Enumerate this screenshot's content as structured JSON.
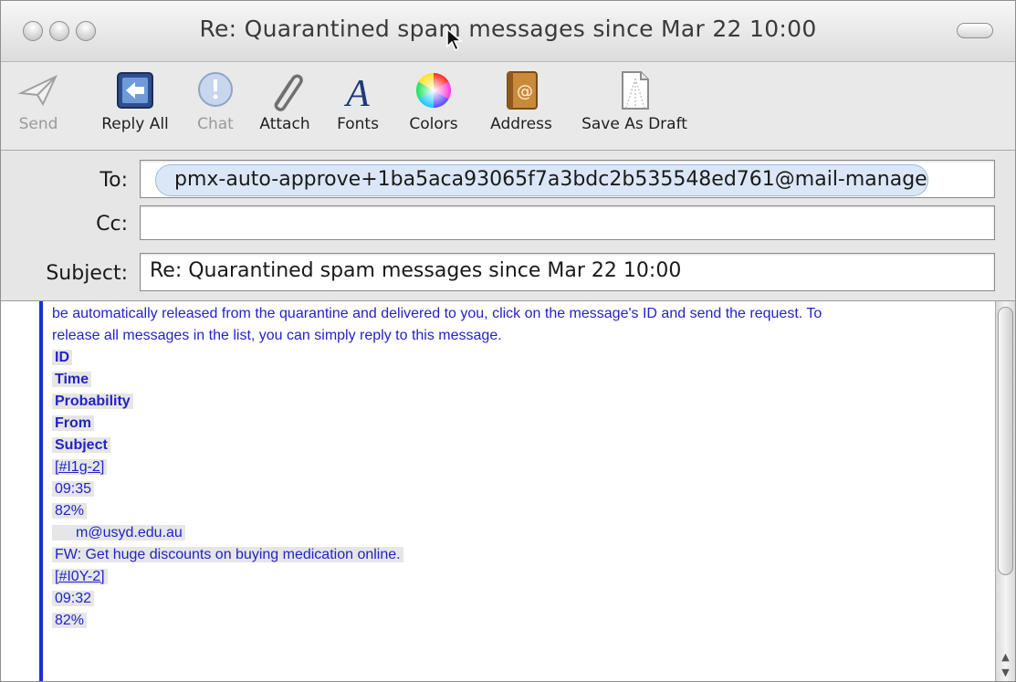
{
  "window": {
    "title": "Re: Quarantined spam messages since Mar 22 10:00"
  },
  "toolbar": {
    "send": "Send",
    "reply_all": "Reply All",
    "chat": "Chat",
    "attach": "Attach",
    "fonts": "Fonts",
    "colors": "Colors",
    "address": "Address",
    "save_draft": "Save As Draft"
  },
  "fields": {
    "to_label": "To:",
    "to_value": "pmx-auto-approve+1ba5aca93065f7a3bdc2b535548ed761@mail-manage",
    "cc_label": "Cc:",
    "cc_value": "",
    "subject_label": "Subject:",
    "subject_value": "Re: Quarantined spam messages since Mar 22 10:00"
  },
  "body": {
    "intro_line1": "be automatically released from the quarantine and delivered to you, click on the message's ID and send the request. To",
    "intro_line2": "release all messages in the list, you can simply reply to this message.",
    "headers": [
      "ID",
      "Time",
      "Probability",
      "From",
      "Subject"
    ],
    "messages": [
      {
        "id": "[#I1g-2]",
        "time": "09:35",
        "probability": "82%",
        "from": "m@usyd.edu.au",
        "subject": "FW: Get huge discounts on buying medication online."
      },
      {
        "id": "[#I0Y-2]",
        "time": "09:32",
        "probability": "82%"
      }
    ]
  },
  "colors": {
    "quote_bar": "#1a2fd0",
    "body_text": "#2323c9"
  }
}
